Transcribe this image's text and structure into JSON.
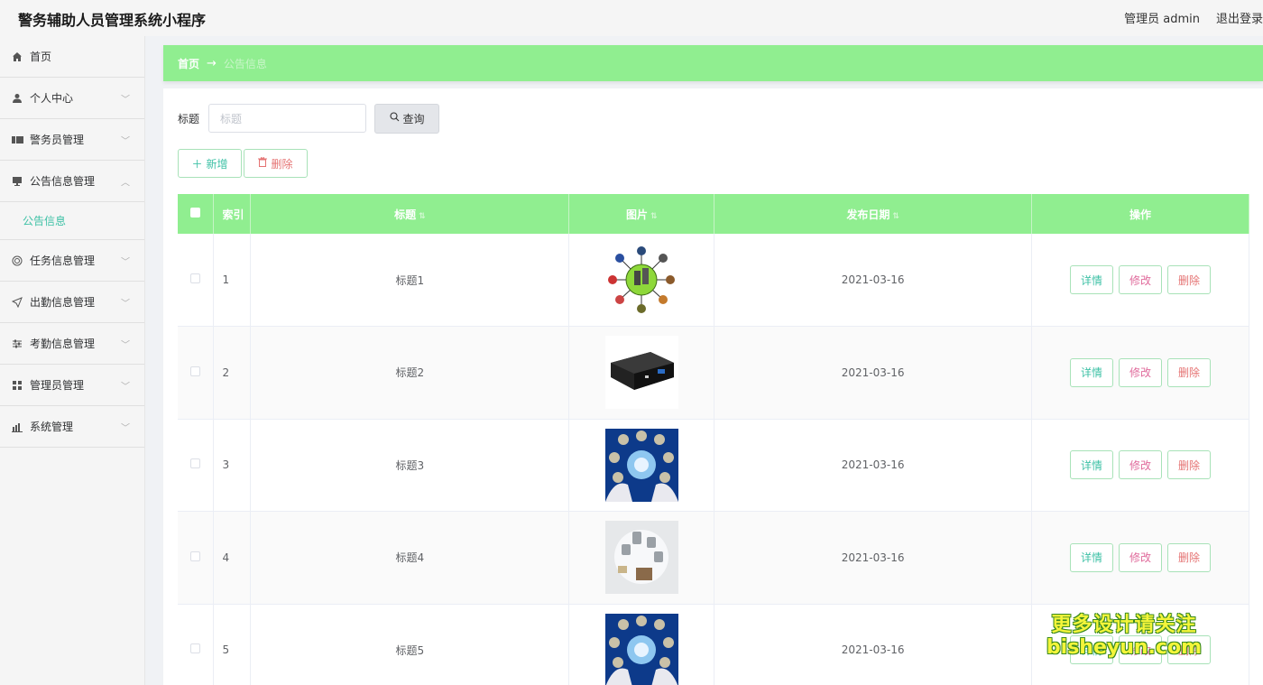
{
  "app": {
    "title": "警务辅助人员管理系统小程序",
    "user_label": "管理员 admin",
    "logout_label": "退出登录"
  },
  "sidebar": {
    "items": [
      {
        "label": "首页",
        "icon": "home-icon",
        "expandable": false
      },
      {
        "label": "个人中心",
        "icon": "user-icon",
        "expandable": true
      },
      {
        "label": "警务员管理",
        "icon": "ticket-icon",
        "expandable": true
      },
      {
        "label": "公告信息管理",
        "icon": "monitor-icon",
        "expandable": true,
        "expanded": true
      },
      {
        "label": "公告信息",
        "icon": "",
        "sub": true,
        "active": true
      },
      {
        "label": "任务信息管理",
        "icon": "target-icon",
        "expandable": true
      },
      {
        "label": "出勤信息管理",
        "icon": "send-icon",
        "expandable": true
      },
      {
        "label": "考勤信息管理",
        "icon": "sliders-icon",
        "expandable": true
      },
      {
        "label": "管理员管理",
        "icon": "grid-icon",
        "expandable": true
      },
      {
        "label": "系统管理",
        "icon": "chart-icon",
        "expandable": true
      }
    ]
  },
  "breadcrumb": {
    "home": "首页",
    "separator": "→",
    "current": "公告信息"
  },
  "search": {
    "label": "标题",
    "placeholder": "标题",
    "button_label": "查询"
  },
  "actions": {
    "add_label": "新增",
    "delete_label": "删除"
  },
  "table": {
    "headers": {
      "index": "索引",
      "title": "标题",
      "image": "图片",
      "date": "发布日期",
      "ops": "操作"
    },
    "rows": [
      {
        "index": "1",
        "title": "标题1",
        "date": "2021-03-16",
        "image": "network-diagram"
      },
      {
        "index": "2",
        "title": "标题2",
        "date": "2021-03-16",
        "image": "black-device"
      },
      {
        "index": "3",
        "title": "标题3",
        "date": "2021-03-16",
        "image": "blue-globe-hands"
      },
      {
        "index": "4",
        "title": "标题4",
        "date": "2021-03-16",
        "image": "cameras"
      },
      {
        "index": "5",
        "title": "标题5",
        "date": "2021-03-16",
        "image": "blue-globe-hands"
      }
    ],
    "op_labels": {
      "detail": "详情",
      "edit": "修改",
      "delete": "删除"
    }
  },
  "watermark": {
    "line1": "更多设计请关注",
    "line2": "bisheyun.com"
  },
  "colors": {
    "accent_green": "#90ee90",
    "teal": "#3ec1a6",
    "danger": "#e57373",
    "edit_pink": "#e06b9c"
  }
}
